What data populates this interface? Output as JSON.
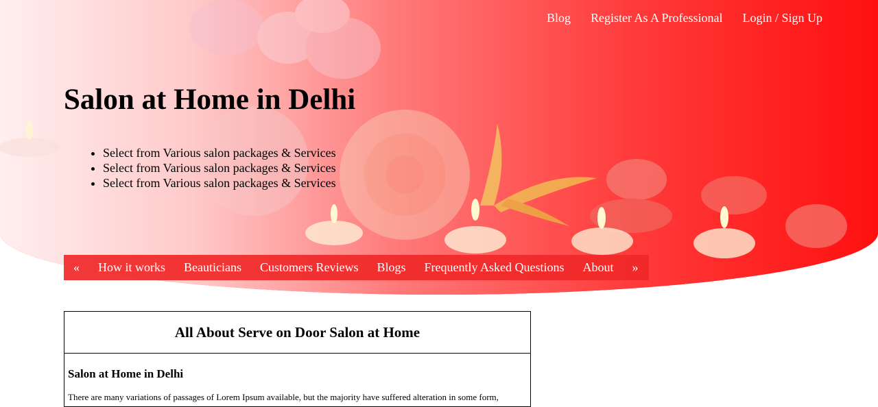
{
  "topnav": {
    "blog": "Blog",
    "register": "Register As A Professional",
    "login": "Login / Sign Up"
  },
  "hero": {
    "title": "Salon at Home in Delhi",
    "features": [
      "Select from Various salon packages & Services",
      "Select from Various salon packages & Services",
      "Select from Various salon packages & Services"
    ]
  },
  "subnav": {
    "prev": "«",
    "items": [
      "How it works",
      "Beauticians",
      "Customers Reviews",
      "Blogs",
      "Frequently Asked Questions",
      "About"
    ],
    "next": "»"
  },
  "about": {
    "header": "All About Serve on Door Salon at Home",
    "subheading": "Salon at Home in Delhi",
    "text": "There are many variations of passages of Lorem Ipsum available, but the majority have suffered alteration in some form,"
  },
  "colors": {
    "brand_red": "#ff1010",
    "nav_red": "#f02828"
  }
}
